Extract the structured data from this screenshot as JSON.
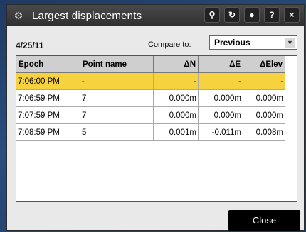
{
  "window": {
    "title": "Largest displacements"
  },
  "toolbar": {
    "info_label": "?",
    "close_x": "×"
  },
  "header": {
    "date": "4/25/11",
    "compare_label": "Compare to:",
    "compare_value": "Previous"
  },
  "table": {
    "columns": [
      "Epoch",
      "Point name",
      "ΔN",
      "ΔE",
      "ΔElev"
    ],
    "rows": [
      {
        "epoch": "7:06:00 PM",
        "point": "-",
        "dn": "-",
        "de": "-",
        "delev": "-"
      },
      {
        "epoch": "7:06:59 PM",
        "point": "7",
        "dn": "0.000m",
        "de": "0.000m",
        "delev": "0.000m"
      },
      {
        "epoch": "7:07:59 PM",
        "point": "7",
        "dn": "0.000m",
        "de": "0.000m",
        "delev": "0.000m"
      },
      {
        "epoch": "7:08:59 PM",
        "point": "5",
        "dn": "0.001m",
        "de": "-0.011m",
        "delev": "0.008m"
      }
    ]
  },
  "footer": {
    "close_label": "Close"
  },
  "colors": {
    "highlight": "#f6d23e",
    "titlebar": "#3a3a3a"
  }
}
